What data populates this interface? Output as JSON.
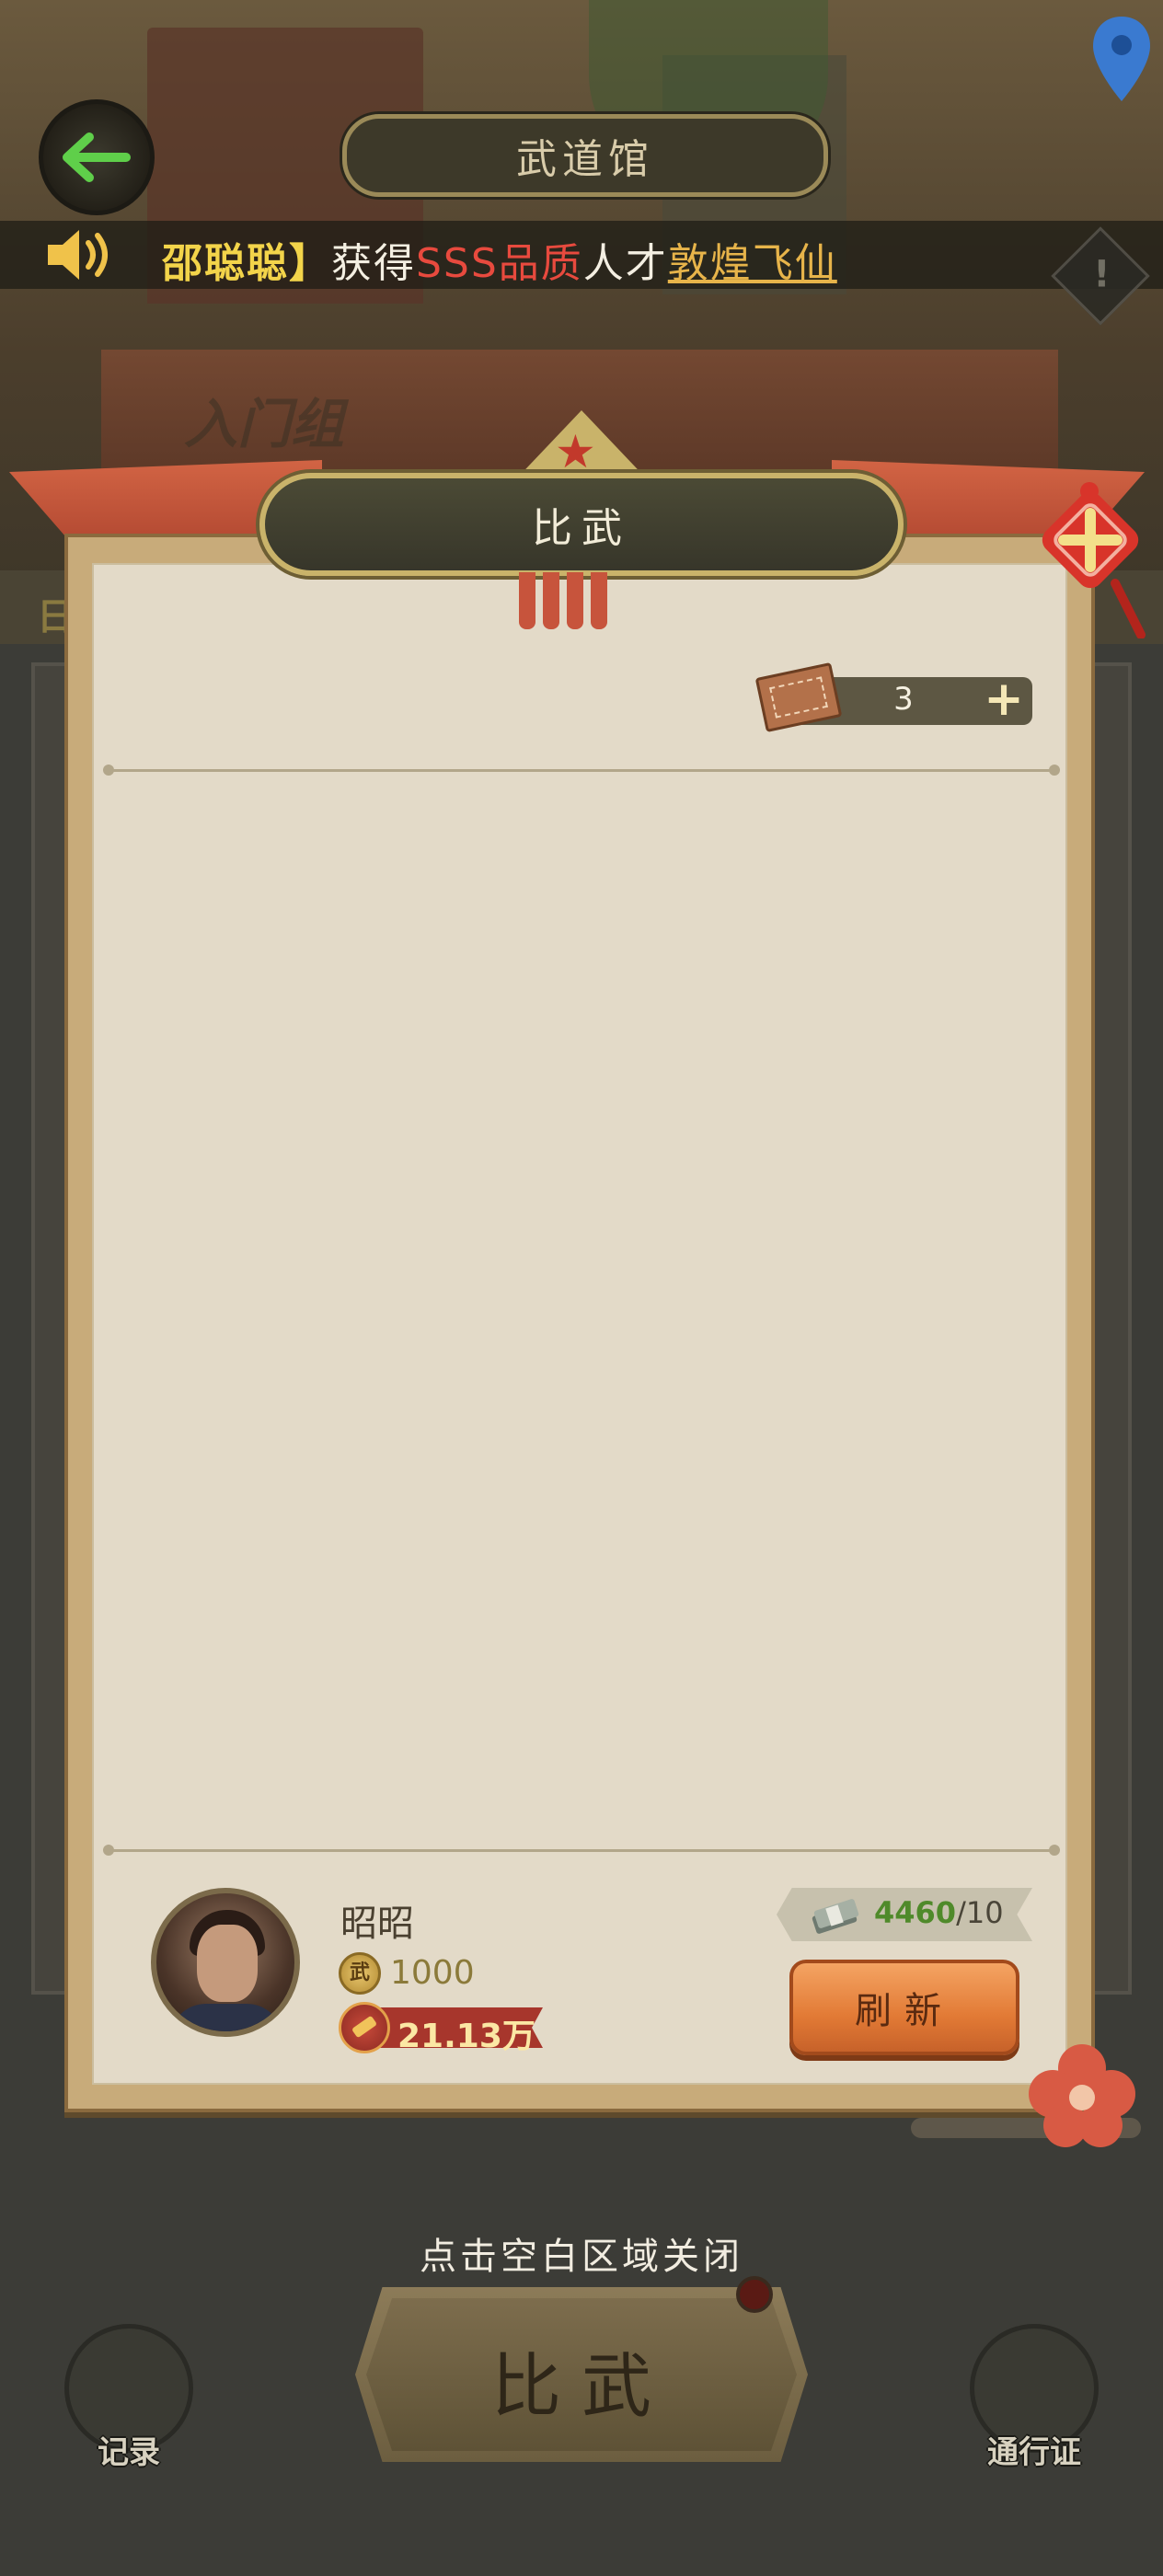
{
  "header": {
    "title": "武道馆",
    "back_icon": "arrow-left-icon",
    "location_icon": "map-pin-icon"
  },
  "marquee": {
    "prefix": "【",
    "name": "邵聪聪",
    "bracket_close": "】",
    "text_got": "获得",
    "quality": "SSS品质",
    "text_talent": "人才",
    "talent_name": "敦煌飞仙"
  },
  "background": {
    "group_label": "入门组",
    "stripe_label": "日"
  },
  "dialog": {
    "title": "比武",
    "ticket_count": "3",
    "ticket_plus": "+",
    "player": {
      "name": "昭昭",
      "score_icon_text": "武",
      "score": "1000",
      "power": "21.13万"
    },
    "money": {
      "current": "4460",
      "max": "/10"
    },
    "refresh_label": "刷新"
  },
  "footer": {
    "close_hint": "点击空白区域关闭",
    "main_button": "比武",
    "record_label": "记录",
    "pass_label": "通行证"
  },
  "colors": {
    "quality_red": "#e84a3e",
    "name_yellow": "#f3d44a",
    "talent_gold": "#e7b44a",
    "refresh_orange": "#e27a35",
    "money_green": "#4f8a2a"
  }
}
